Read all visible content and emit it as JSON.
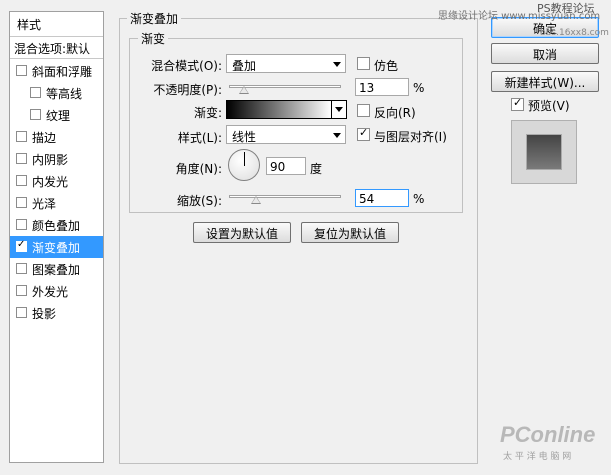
{
  "styles_panel": {
    "header": "样式",
    "blend_options": "混合选项:默认",
    "items": [
      {
        "label": "斜面和浮雕",
        "checked": false,
        "selected": false
      },
      {
        "label": "等高线",
        "checked": false,
        "selected": false
      },
      {
        "label": "纹理",
        "checked": false,
        "selected": false
      },
      {
        "label": "描边",
        "checked": false,
        "selected": false
      },
      {
        "label": "内阴影",
        "checked": false,
        "selected": false
      },
      {
        "label": "内发光",
        "checked": false,
        "selected": false
      },
      {
        "label": "光泽",
        "checked": false,
        "selected": false
      },
      {
        "label": "颜色叠加",
        "checked": false,
        "selected": false
      },
      {
        "label": "渐变叠加",
        "checked": true,
        "selected": true
      },
      {
        "label": "图案叠加",
        "checked": false,
        "selected": false
      },
      {
        "label": "外发光",
        "checked": false,
        "selected": false
      },
      {
        "label": "投影",
        "checked": false,
        "selected": false
      }
    ]
  },
  "gradient_overlay": {
    "group_title": "渐变叠加",
    "subgroup_title": "渐变",
    "blend_mode_label": "混合模式(O):",
    "blend_mode_value": "叠加",
    "dither_label": "仿色",
    "dither_checked": false,
    "opacity_label": "不透明度(P):",
    "opacity_value": "13",
    "opacity_unit": "%",
    "opacity_level": 0.13,
    "gradient_label": "渐变:",
    "gradient_colors": [
      "#000000",
      "#ffffff"
    ],
    "reverse_label": "反向(R)",
    "reverse_checked": false,
    "style_label": "样式(L):",
    "style_value": "线性",
    "align_label": "与图层对齐(I)",
    "align_checked": true,
    "angle_label": "角度(N):",
    "angle_value": "90",
    "angle_unit": "度",
    "scale_label": "缩放(S):",
    "scale_value": "54",
    "scale_unit": "%",
    "scale_level": 0.54,
    "make_default_label": "设置为默认值",
    "reset_default_label": "复位为默认值"
  },
  "right_panel": {
    "ok_label": "确定",
    "cancel_label": "取消",
    "new_style_label": "新建样式(W)...",
    "preview_label": "预览(V)",
    "preview_checked": true
  },
  "watermarks": {
    "top_right": "思缘设计论坛 www.missyuan.com",
    "top_right_2": "PS教程论坛",
    "top_right_3": "bbs.16xx8.com",
    "bottom_logo": "PConline",
    "bottom_sub": "太 平 洋 电 脑 网"
  },
  "colors": {
    "selection": "#3399ff",
    "background": "#f0f0f0"
  }
}
